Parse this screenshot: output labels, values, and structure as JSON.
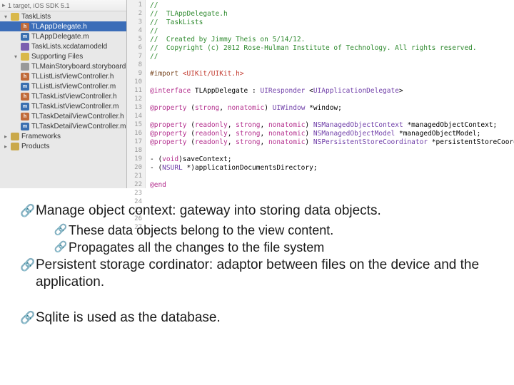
{
  "ide": {
    "target": "1 target, iOS SDK 5.1",
    "tree": [
      {
        "label": "TaskLists",
        "type": "folder",
        "indent": 0,
        "open": true
      },
      {
        "label": "TLAppDelegate.h",
        "type": "h",
        "indent": 1,
        "selected": true
      },
      {
        "label": "TLAppDelegate.m",
        "type": "m",
        "indent": 1
      },
      {
        "label": "TaskLists.xcdatamodeld",
        "type": "datamodel",
        "indent": 1
      },
      {
        "label": "Supporting Files",
        "type": "folder",
        "indent": 1,
        "open": true
      },
      {
        "label": "TLMainStoryboard.storyboard",
        "type": "storyboard",
        "indent": 1
      },
      {
        "label": "TLListListViewController.h",
        "type": "h",
        "indent": 1
      },
      {
        "label": "TLListListViewController.m",
        "type": "m",
        "indent": 1
      },
      {
        "label": "TLTaskListViewController.h",
        "type": "h",
        "indent": 1
      },
      {
        "label": "TLTaskListViewController.m",
        "type": "m",
        "indent": 1
      },
      {
        "label": "TLTaskDetailViewController.h",
        "type": "h",
        "indent": 1
      },
      {
        "label": "TLTaskDetailViewController.m",
        "type": "m",
        "indent": 1
      },
      {
        "label": "Frameworks",
        "type": "framework",
        "indent": 0
      },
      {
        "label": "Products",
        "type": "framework",
        "indent": 0
      }
    ],
    "line_start": 1,
    "line_end": 27,
    "code": [
      {
        "cls": "c-comment",
        "t": "//"
      },
      {
        "cls": "c-comment",
        "t": "//  TLAppDelegate.h"
      },
      {
        "cls": "c-comment",
        "t": "//  TaskLists"
      },
      {
        "cls": "c-comment",
        "t": "//"
      },
      {
        "cls": "c-comment",
        "t": "//  Created by Jimmy Theis on 5/14/12."
      },
      {
        "cls": "c-comment",
        "t": "//  Copyright (c) 2012 Rose-Hulman Institute of Technology. All rights reserved."
      },
      {
        "cls": "c-comment",
        "t": "//"
      },
      {
        "cls": "",
        "t": ""
      },
      {
        "segments": [
          {
            "cls": "c-preproc",
            "t": "#import "
          },
          {
            "cls": "c-import",
            "t": "<UIKit/UIKit.h>"
          }
        ]
      },
      {
        "cls": "",
        "t": ""
      },
      {
        "segments": [
          {
            "cls": "c-keyword",
            "t": "@interface"
          },
          {
            "cls": "c-plain",
            "t": " TLAppDelegate : "
          },
          {
            "cls": "c-type",
            "t": "UIResponder"
          },
          {
            "cls": "c-plain",
            "t": " <"
          },
          {
            "cls": "c-type",
            "t": "UIApplicationDelegate"
          },
          {
            "cls": "c-plain",
            "t": ">"
          }
        ]
      },
      {
        "cls": "",
        "t": ""
      },
      {
        "segments": [
          {
            "cls": "c-keyword",
            "t": "@property"
          },
          {
            "cls": "c-plain",
            "t": " ("
          },
          {
            "cls": "c-keyword",
            "t": "strong"
          },
          {
            "cls": "c-plain",
            "t": ", "
          },
          {
            "cls": "c-keyword",
            "t": "nonatomic"
          },
          {
            "cls": "c-plain",
            "t": ") "
          },
          {
            "cls": "c-type",
            "t": "UIWindow"
          },
          {
            "cls": "c-plain",
            "t": " *window;"
          }
        ]
      },
      {
        "cls": "",
        "t": ""
      },
      {
        "segments": [
          {
            "cls": "c-keyword",
            "t": "@property"
          },
          {
            "cls": "c-plain",
            "t": " ("
          },
          {
            "cls": "c-keyword",
            "t": "readonly"
          },
          {
            "cls": "c-plain",
            "t": ", "
          },
          {
            "cls": "c-keyword",
            "t": "strong"
          },
          {
            "cls": "c-plain",
            "t": ", "
          },
          {
            "cls": "c-keyword",
            "t": "nonatomic"
          },
          {
            "cls": "c-plain",
            "t": ") "
          },
          {
            "cls": "c-type",
            "t": "NSManagedObjectContext"
          },
          {
            "cls": "c-plain",
            "t": " *managedObjectContext;"
          }
        ]
      },
      {
        "segments": [
          {
            "cls": "c-keyword",
            "t": "@property"
          },
          {
            "cls": "c-plain",
            "t": " ("
          },
          {
            "cls": "c-keyword",
            "t": "readonly"
          },
          {
            "cls": "c-plain",
            "t": ", "
          },
          {
            "cls": "c-keyword",
            "t": "strong"
          },
          {
            "cls": "c-plain",
            "t": ", "
          },
          {
            "cls": "c-keyword",
            "t": "nonatomic"
          },
          {
            "cls": "c-plain",
            "t": ") "
          },
          {
            "cls": "c-type",
            "t": "NSManagedObjectModel"
          },
          {
            "cls": "c-plain",
            "t": " *managedObjectModel;"
          }
        ]
      },
      {
        "segments": [
          {
            "cls": "c-keyword",
            "t": "@property"
          },
          {
            "cls": "c-plain",
            "t": " ("
          },
          {
            "cls": "c-keyword",
            "t": "readonly"
          },
          {
            "cls": "c-plain",
            "t": ", "
          },
          {
            "cls": "c-keyword",
            "t": "strong"
          },
          {
            "cls": "c-plain",
            "t": ", "
          },
          {
            "cls": "c-keyword",
            "t": "nonatomic"
          },
          {
            "cls": "c-plain",
            "t": ") "
          },
          {
            "cls": "c-type",
            "t": "NSPersistentStoreCoordinator"
          },
          {
            "cls": "c-plain",
            "t": " *persistentStoreCoordinator;"
          }
        ]
      },
      {
        "cls": "",
        "t": ""
      },
      {
        "segments": [
          {
            "cls": "c-plain",
            "t": "- ("
          },
          {
            "cls": "c-keyword",
            "t": "void"
          },
          {
            "cls": "c-plain",
            "t": ")saveContext;"
          }
        ]
      },
      {
        "segments": [
          {
            "cls": "c-plain",
            "t": "- ("
          },
          {
            "cls": "c-type",
            "t": "NSURL"
          },
          {
            "cls": "c-plain",
            "t": " *)applicationDocumentsDirectory;"
          }
        ]
      },
      {
        "cls": "",
        "t": ""
      },
      {
        "cls": "c-keyword",
        "t": "@end"
      },
      {
        "cls": "",
        "t": ""
      },
      {
        "cls": "",
        "t": ""
      },
      {
        "cls": "",
        "t": ""
      },
      {
        "cls": "",
        "t": ""
      },
      {
        "cls": "",
        "t": ""
      }
    ]
  },
  "notes": {
    "b1": "Manage object context: gateway into storing data objects.",
    "s1": "These data objects belong to the view content.",
    "s2": "Propagates all the changes to the file system",
    "b2": "Persistent storage cordinator: adaptor between files on the device and the application.",
    "b3": "Sqlite is used as the database."
  }
}
